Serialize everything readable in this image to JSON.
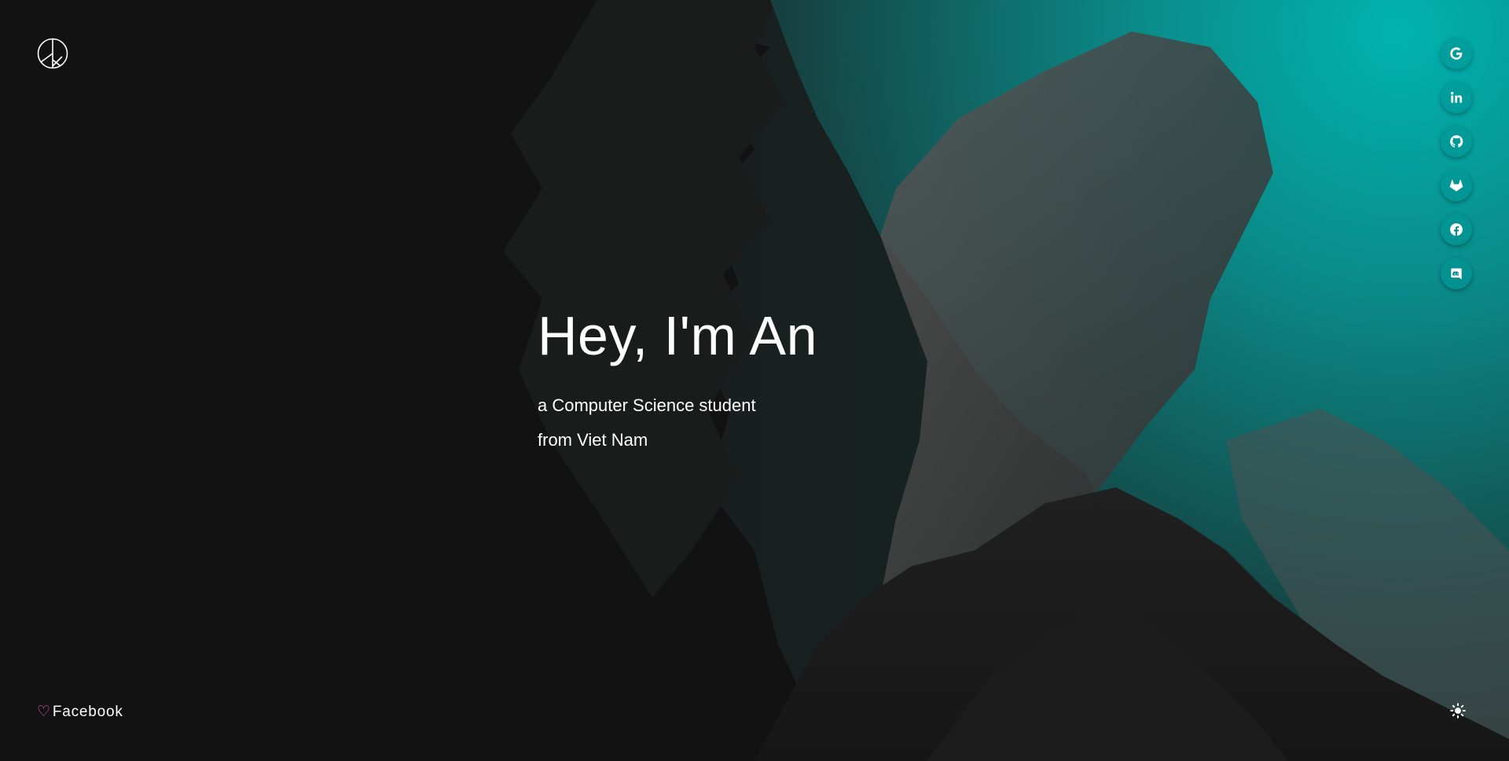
{
  "logo": {
    "icon": "peace-logo-icon"
  },
  "hero": {
    "title": "Hey, I'm An",
    "subtitle_line1": "a Computer Science student",
    "subtitle_line2": "from Viet Nam"
  },
  "socials": [
    {
      "icon": "google-icon"
    },
    {
      "icon": "linkedin-icon"
    },
    {
      "icon": "github-icon"
    },
    {
      "icon": "gitlab-icon"
    },
    {
      "icon": "facebook-icon"
    },
    {
      "icon": "discord-icon"
    }
  ],
  "footer": {
    "heart": "♡",
    "link_label": "Facebook"
  },
  "theme_toggle": {
    "icon": "sun-icon"
  },
  "colors": {
    "background": "#121212",
    "accent": "#00a8a8",
    "heart": "#e86aa1"
  }
}
